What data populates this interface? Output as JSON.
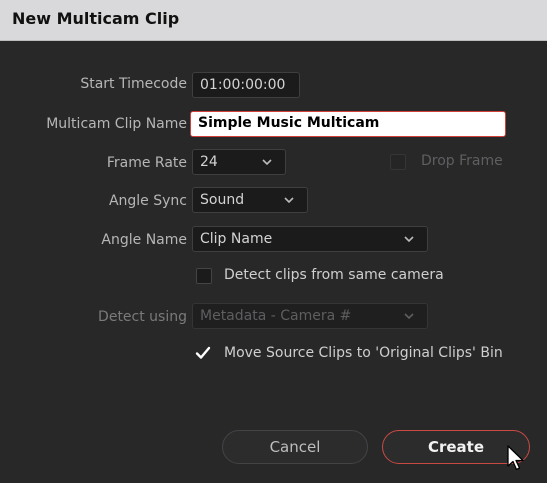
{
  "dialog": {
    "title": "New Multicam Clip"
  },
  "fields": {
    "start_timecode": {
      "label": "Start Timecode",
      "value": "01:00:00:00"
    },
    "clip_name": {
      "label": "Multicam Clip Name",
      "value": "Simple Music Multicam"
    },
    "frame_rate": {
      "label": "Frame Rate",
      "value": "24"
    },
    "angle_sync": {
      "label": "Angle Sync",
      "value": "Sound"
    },
    "angle_name": {
      "label": "Angle Name",
      "value": "Clip Name"
    },
    "detect_using": {
      "label": "Detect using",
      "value": "Metadata - Camera #"
    }
  },
  "checkboxes": {
    "drop_frame": {
      "label": "Drop Frame",
      "checked": false,
      "enabled": false
    },
    "detect_same_camera": {
      "label": "Detect clips from same camera",
      "checked": false,
      "enabled": true
    },
    "move_source": {
      "label": "Move Source Clips to 'Original Clips' Bin",
      "checked": true,
      "enabled": true
    }
  },
  "buttons": {
    "cancel": "Cancel",
    "create": "Create"
  },
  "colors": {
    "accent": "#d1403a",
    "background": "#282829",
    "titlebar": "#d9d9db"
  },
  "icons": {
    "dropdown": "chevron-down-icon",
    "check": "checkmark-icon",
    "cursor": "mouse-pointer-icon"
  }
}
